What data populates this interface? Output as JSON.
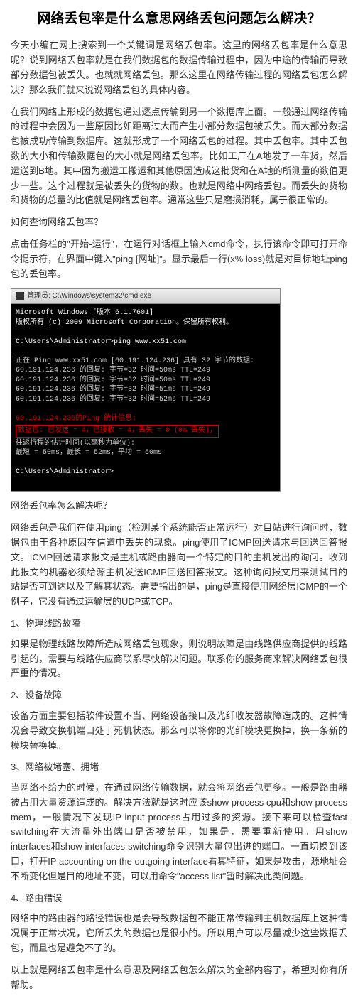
{
  "title": "网络丢包率是什么意思网络丢包问题怎么解决？",
  "intro1": "今天小编在网上搜索到一个关键词是网络丢包率。这里的网络丢包率是什么意思呢？说到网络丢包率就是在我们数据包的数据传输过程中，因为中途的传输而导致部分数据包被丢失。也就就网络丢包。那么这里在网络传输过程的网络丢包怎么解决？那么我们就来说说网络丢包的具体内容。",
  "intro2": "在我们网络上形成的数据包通过逐点传输到另一个数据库上面。一般通过网络传输的过程中会因为一些原因比如距离过大而产生小部分数据包被丢失。而大部分数据包被成功传输到数据库。这就形成了一个网络丢包的过程。其中丢包率。其中丢包数的大小和传输数据包的大小就是网络丢包率。比如工厂在A地发了一车货，然后运送到B地。其中因为搬运工搬运和其他原因造成这批货和在A地的所测量的数值更少一些。这个过程就是被丢失的货物的数。也就是网络中网络丢包。而丢失的货物和货物的总量的比值就是网络丢包率。通常这些只是磨损消耗，属于很正常的。",
  "how_query": "如何查询网络丢包率？",
  "query_instruction": "点击任务栏的\"开始-运行\"，在运行对话框上输入cmd命令，执行该命令即可打开命令提示符，在界面中键入\"ping [网址]\"。显示最后一行(x% loss)就是对目标地址ping包的丢包率。",
  "terminal": {
    "title": "管理员: C:\\Windows\\system32\\cmd.exe",
    "header": "Microsoft Windows [版本 6.1.7601]",
    "copyright": "版权所有 (c) 2009 Microsoft Corporation。保留所有权利。",
    "prompt1": "C:\\Users\\Administrator>ping www.xx51.com",
    "ping_header": "正在 Ping www.xx51.com [60.191.124.236] 具有 32 字节的数据:",
    "reply1": "60.191.124.236 的回复: 字节=32 时间=50ms TTL=249",
    "reply2": "60.191.124.236 的回复: 字节=32 时间=50ms TTL=249",
    "reply3": "60.191.124.236 的回复: 字节=32 时间=51ms TTL=249",
    "reply4": "60.191.124.236 的回复: 字节=32 时间=52ms TTL=249",
    "stats_header": "60.191.124.236的Ping 统计信息:",
    "stats_packets": "数据包: 已发送 = 4，已接收 = 4，丢失 = 0 (0% 丢失)，",
    "stats_time_header": "往返行程的估计时间(以毫秒为单位):",
    "stats_time": "最短 = 50ms，最长 = 52ms，平均 = 50ms",
    "prompt2": "C:\\Users\\Administrator>"
  },
  "how_solve": "网络丢包率怎么解决呢？",
  "solve_intro": "网络丢包是我们在使用ping（检测某个系统能否正常运行）对目站进行询问时，数据包由于各种原因在信道中丢失的现象。ping使用了ICMP回送请求与回送回答报文。ICMP回送请求报文是主机或路由器向一个特定的目的主机发出的询问。收到此报文的机器必须给源主机发送ICMP回送回答报文。这种询问报文用来测试目的站是否可到达以及了解其状态。需要指出的是，ping是直接使用网络层ICMP的一个例子，它没有通过运输层的UDP或TCP。",
  "sec1": "1、物理线路故障",
  "sec1_body": "如果是物理线路故障所造成网络丢包现象，则说明故障是由线路供应商提供的线路引起的，需要与线路供应商联系尽快解决问题。联系你的服务商来解决网络丢包很严重的情况。",
  "sec2": "2、设备故障",
  "sec2_body": "设备方面主要包括软件设置不当、网络设备接口及光纤收发器故障造成的。这种情况会导致交换机端口处于死机状态。那么可以将你的光纤模块更换掉，换一条新的模块替换掉。",
  "sec3": "3、网络被堵塞、拥堵",
  "sec3_body": "当网络不给力的时候，在通过网络传输数据，就会将网络丢包更多。一般是路由器被占用大量资源造成的。解决方法就是这时应该show process cpu和show process mem，一般情况下发现IP input process占用过多的资源。接下来可以检查fast switching在大流量外出端口是否被禁用，如果是，需要重新使用。用show interfaces和show interfaces switching命令识别大量包出进的端口。一直切换到该口，打开IP accounting on the outgoing interface看其特征，如果是攻击，源地址会不断变化但是目的地址不变，可以用命令\"access list\"暂时解决此类问题。",
  "sec4": "4、路由错误",
  "sec4_body": "网络中的路由器的路径错误也是会导致数据包不能正常传输到主机数据库上这种情况属于正常状况，它所丢失的数据也是很小的。所以用户可以尽量减少这些数据丢包，而且也是避免不了的。",
  "conclusion": "以上就是网络丢包率是什么意思及网络丢包怎么解决的全部内容了，希望对你有所帮助。"
}
